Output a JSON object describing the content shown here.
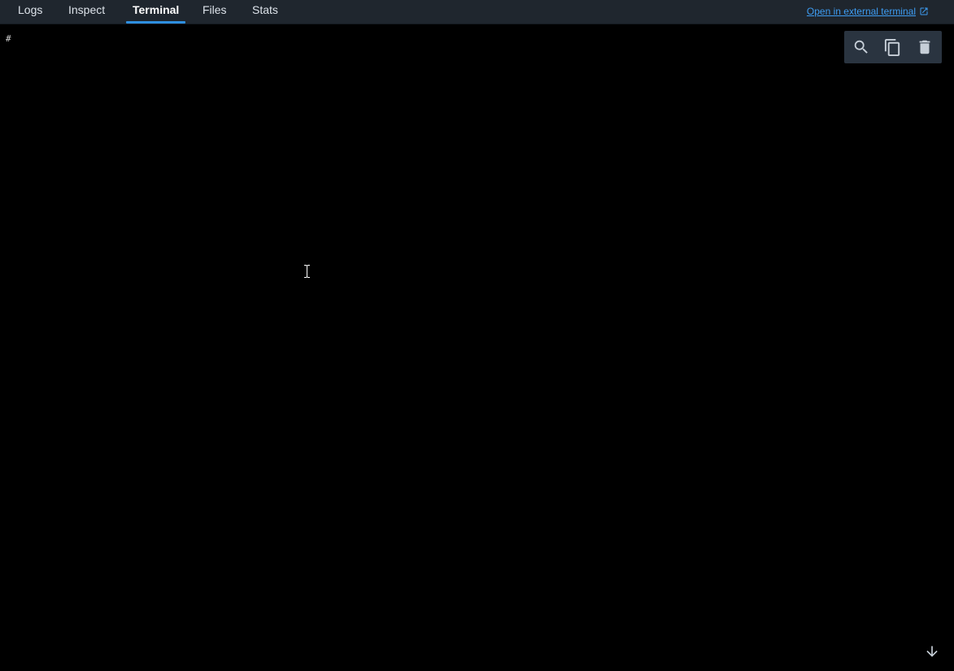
{
  "tabs": [
    {
      "label": "Logs",
      "active": false
    },
    {
      "label": "Inspect",
      "active": false
    },
    {
      "label": "Terminal",
      "active": true
    },
    {
      "label": "Files",
      "active": false
    },
    {
      "label": "Stats",
      "active": false
    }
  ],
  "external_link": {
    "label": "Open in external terminal",
    "icon": "external-link-icon"
  },
  "terminal": {
    "prompt": "#"
  },
  "toolbar": {
    "icons": [
      "search-icon",
      "copy-icon",
      "trash-icon"
    ]
  },
  "scroll": {
    "icon": "arrow-down-icon"
  },
  "colors": {
    "accent": "#2e8fe0",
    "link": "#3d9cf2",
    "tabbar_bg": "#1f262e",
    "terminal_bg": "#000000"
  }
}
